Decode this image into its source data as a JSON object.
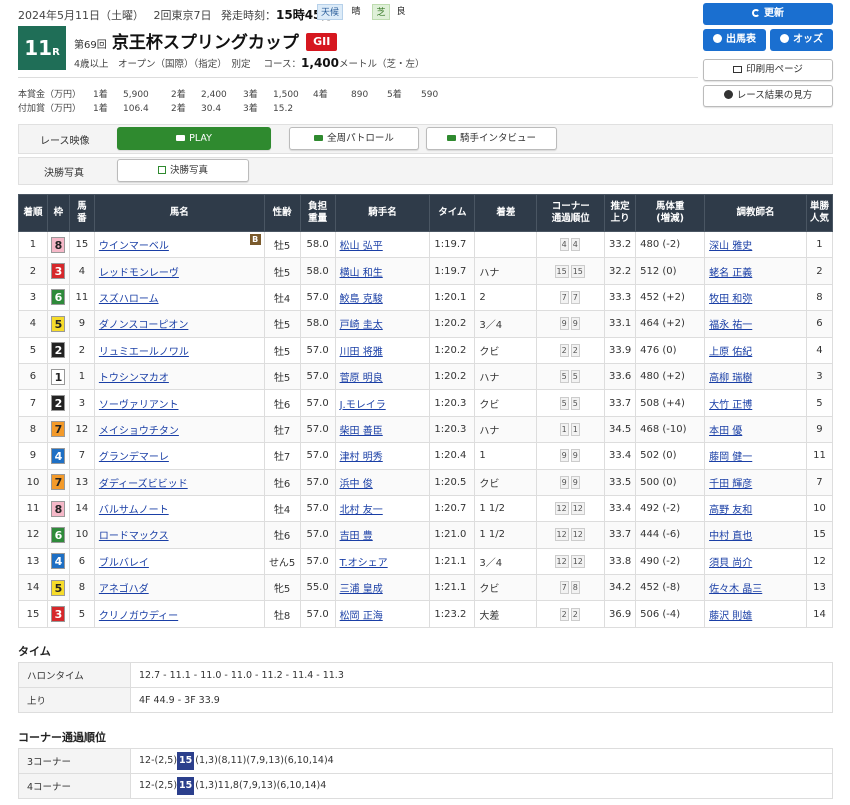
{
  "header": {
    "date": "2024年5月11日（土曜）",
    "meeting": "2回東京7日",
    "start_label": "発走時刻：",
    "start_time": "15時45分",
    "weather_label": "天候",
    "weather": "晴",
    "track_label": "芝",
    "track_cond": "良"
  },
  "race": {
    "number": "11",
    "number_suffix": "R",
    "kai": "第69回",
    "name": "京王杯スプリングカップ",
    "grade": "GII",
    "conditions": "4歳以上　オープン（国際）（指定）　別定",
    "course_label": "コース：",
    "distance": "1,400",
    "distance_unit": "メートル（芝・左）"
  },
  "prize": {
    "row1_label": "本賞金（万円）",
    "row1": [
      "1着",
      "5,900",
      "2着",
      "2,400",
      "3着",
      "1,500",
      "4着",
      "890",
      "5着",
      "590"
    ],
    "row2_label": "付加賞（万円）",
    "row2": [
      "1着",
      "106.4",
      "2着",
      "30.4",
      "3着",
      "15.2"
    ]
  },
  "actions": {
    "refresh": "更新",
    "entries": "出馬表",
    "odds": "オッズ",
    "print": "印刷用ページ",
    "howto": "レース結果の見方"
  },
  "video": {
    "race_video_label": "レース映像",
    "play": "PLAY",
    "patrol": "全周パトロール",
    "interview": "騎手インタビュー",
    "photo_label": "決勝写真",
    "photo_btn": "決勝写真"
  },
  "table": {
    "headers": [
      [
        "着順"
      ],
      [
        "枠"
      ],
      [
        "馬",
        "番"
      ],
      [
        "馬名"
      ],
      [
        "性齢"
      ],
      [
        "負担",
        "重量"
      ],
      [
        "騎手名"
      ],
      [
        "タイム"
      ],
      [
        "着差"
      ],
      [
        "コーナー",
        "通過順位"
      ],
      [
        "推定",
        "上り"
      ],
      [
        "馬体重",
        "(増減)"
      ],
      [
        "調教師名"
      ],
      [
        "単勝",
        "人気"
      ]
    ],
    "blinker_mark": "B",
    "rows": [
      {
        "rank": "1",
        "waku": "8",
        "num": "15",
        "horse": "ウインマーベル",
        "blinker": true,
        "sex_age": "牡5",
        "weight": "58.0",
        "jockey": "松山 弘平",
        "time": "1:19.7",
        "margin": "",
        "corner": [
          "4",
          "4"
        ],
        "last3f": "33.2",
        "body": "480 (-2)",
        "trainer": "深山 雅史",
        "pop": "1"
      },
      {
        "rank": "2",
        "waku": "3",
        "num": "4",
        "horse": "レッドモンレーヴ",
        "blinker": false,
        "sex_age": "牡5",
        "weight": "58.0",
        "jockey": "横山 和生",
        "time": "1:19.7",
        "margin": "ハナ",
        "corner": [
          "15",
          "15"
        ],
        "last3f": "32.2",
        "body": "512 (0)",
        "trainer": "蛯名 正義",
        "pop": "2"
      },
      {
        "rank": "3",
        "waku": "6",
        "num": "11",
        "horse": "スズハローム",
        "blinker": false,
        "sex_age": "牡4",
        "weight": "57.0",
        "jockey": "鮫島 克駿",
        "time": "1:20.1",
        "margin": "2",
        "corner": [
          "7",
          "7"
        ],
        "last3f": "33.3",
        "body": "452 (+2)",
        "trainer": "牧田 和弥",
        "pop": "8"
      },
      {
        "rank": "4",
        "waku": "5",
        "num": "9",
        "horse": "ダノンスコーピオン",
        "blinker": false,
        "sex_age": "牡5",
        "weight": "58.0",
        "jockey": "戸崎 圭太",
        "time": "1:20.2",
        "margin": "3／4",
        "corner": [
          "9",
          "9"
        ],
        "last3f": "33.1",
        "body": "464 (+2)",
        "trainer": "福永 祐一",
        "pop": "6"
      },
      {
        "rank": "5",
        "waku": "2",
        "num": "2",
        "horse": "リュミエールノワル",
        "blinker": false,
        "sex_age": "牡5",
        "weight": "57.0",
        "jockey": "川田 将雅",
        "time": "1:20.2",
        "margin": "クビ",
        "corner": [
          "2",
          "2"
        ],
        "last3f": "33.9",
        "body": "476 (0)",
        "trainer": "上原 佑紀",
        "pop": "4"
      },
      {
        "rank": "6",
        "waku": "1",
        "num": "1",
        "horse": "トウシンマカオ",
        "blinker": false,
        "sex_age": "牡5",
        "weight": "57.0",
        "jockey": "菅原 明良",
        "time": "1:20.2",
        "margin": "ハナ",
        "corner": [
          "5",
          "5"
        ],
        "last3f": "33.6",
        "body": "480 (+2)",
        "trainer": "高柳 瑞樹",
        "pop": "3"
      },
      {
        "rank": "7",
        "waku": "2",
        "num": "3",
        "horse": "ソーヴァリアント",
        "blinker": false,
        "sex_age": "牡6",
        "weight": "57.0",
        "jockey": "J.モレイラ",
        "time": "1:20.3",
        "margin": "クビ",
        "corner": [
          "5",
          "5"
        ],
        "last3f": "33.7",
        "body": "508 (+4)",
        "trainer": "大竹 正博",
        "pop": "5"
      },
      {
        "rank": "8",
        "waku": "7",
        "num": "12",
        "horse": "メイショウチタン",
        "blinker": false,
        "sex_age": "牡7",
        "weight": "57.0",
        "jockey": "柴田 善臣",
        "time": "1:20.3",
        "margin": "ハナ",
        "corner": [
          "1",
          "1"
        ],
        "last3f": "34.5",
        "body": "468 (-10)",
        "trainer": "本田 優",
        "pop": "9"
      },
      {
        "rank": "9",
        "waku": "4",
        "num": "7",
        "horse": "グランデマーレ",
        "blinker": false,
        "sex_age": "牡7",
        "weight": "57.0",
        "jockey": "津村 明秀",
        "time": "1:20.4",
        "margin": "1",
        "corner": [
          "9",
          "9"
        ],
        "last3f": "33.4",
        "body": "502 (0)",
        "trainer": "藤岡 健一",
        "pop": "11"
      },
      {
        "rank": "10",
        "waku": "7",
        "num": "13",
        "horse": "ダディーズビビッド",
        "blinker": false,
        "sex_age": "牡6",
        "weight": "57.0",
        "jockey": "浜中 俊",
        "time": "1:20.5",
        "margin": "クビ",
        "corner": [
          "9",
          "9"
        ],
        "last3f": "33.5",
        "body": "500 (0)",
        "trainer": "千田 輝彦",
        "pop": "7"
      },
      {
        "rank": "11",
        "waku": "8",
        "num": "14",
        "horse": "バルサムノート",
        "blinker": false,
        "sex_age": "牡4",
        "weight": "57.0",
        "jockey": "北村 友一",
        "time": "1:20.7",
        "margin": "1 1/2",
        "corner": [
          "12",
          "12"
        ],
        "last3f": "33.4",
        "body": "492 (-2)",
        "trainer": "高野 友和",
        "pop": "10"
      },
      {
        "rank": "12",
        "waku": "6",
        "num": "10",
        "horse": "ロードマックス",
        "blinker": false,
        "sex_age": "牡6",
        "weight": "57.0",
        "jockey": "吉田 豊",
        "time": "1:21.0",
        "margin": "1 1/2",
        "corner": [
          "12",
          "12"
        ],
        "last3f": "33.7",
        "body": "444 (-6)",
        "trainer": "中村 直也",
        "pop": "15"
      },
      {
        "rank": "13",
        "waku": "4",
        "num": "6",
        "horse": "ブルバレイ",
        "blinker": false,
        "sex_age": "せん5",
        "weight": "57.0",
        "jockey": "T.オシェア",
        "time": "1:21.1",
        "margin": "3／4",
        "corner": [
          "12",
          "12"
        ],
        "last3f": "33.8",
        "body": "490 (-2)",
        "trainer": "須貝 尚介",
        "pop": "12"
      },
      {
        "rank": "14",
        "waku": "5",
        "num": "8",
        "horse": "アネゴハダ",
        "blinker": false,
        "sex_age": "牝5",
        "weight": "55.0",
        "jockey": "三浦 皇成",
        "time": "1:21.1",
        "margin": "クビ",
        "corner": [
          "7",
          "8"
        ],
        "last3f": "34.2",
        "body": "452 (-8)",
        "trainer": "佐々木 晶三",
        "pop": "13"
      },
      {
        "rank": "15",
        "waku": "3",
        "num": "5",
        "horse": "クリノガウディー",
        "blinker": false,
        "sex_age": "牡8",
        "weight": "57.0",
        "jockey": "松岡 正海",
        "time": "1:23.2",
        "margin": "大差",
        "corner": [
          "2",
          "2"
        ],
        "last3f": "36.9",
        "body": "506 (-4)",
        "trainer": "藤沢 則雄",
        "pop": "14"
      }
    ]
  },
  "waku_colors": {
    "1": {
      "bg": "#ffffff",
      "fg": "#222222"
    },
    "2": {
      "bg": "#222222",
      "fg": "#ffffff"
    },
    "3": {
      "bg": "#d6282b",
      "fg": "#ffffff"
    },
    "4": {
      "bg": "#1e6fc4",
      "fg": "#ffffff"
    },
    "5": {
      "bg": "#f7dc2a",
      "fg": "#222222"
    },
    "6": {
      "bg": "#2e8a3a",
      "fg": "#ffffff"
    },
    "7": {
      "bg": "#f39a2a",
      "fg": "#222222"
    },
    "8": {
      "bg": "#f5b8c8",
      "fg": "#222222"
    }
  },
  "timing": {
    "title": "タイム",
    "furlong_label": "ハロンタイム",
    "furlong": "12.7 - 11.1 - 11.0 - 11.0 - 11.2 - 11.4 - 11.3",
    "agari_label": "上り",
    "agari": "4F 44.9 - 3F 33.9"
  },
  "corners": {
    "title": "コーナー通過順位",
    "c3_label": "3コーナー",
    "c3_pre": "12-(2,5)",
    "c3_badge": "15",
    "c3_post": "(1,3)(8,11)(7,9,13)(6,10,14)4",
    "c4_label": "4コーナー",
    "c4_pre": "12-(2,5)",
    "c4_badge": "15",
    "c4_post": "(1,3)11,8(7,9,13)(6,10,14)4"
  }
}
